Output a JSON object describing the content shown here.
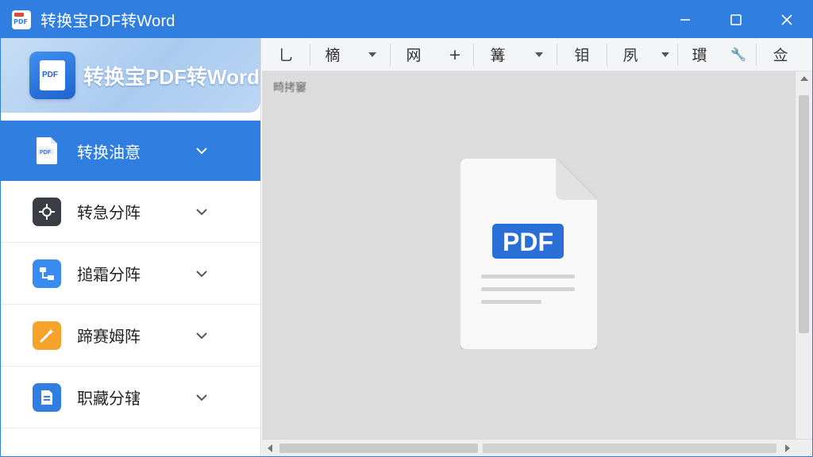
{
  "window": {
    "title": "转换宝PDF转Word",
    "controls": [
      "minimize-icon",
      "maximize-icon",
      "close-icon"
    ]
  },
  "brand": {
    "name": "转换宝PDF转Word",
    "logo_text": "PDF"
  },
  "colors": {
    "accent": "#2f7ee0",
    "brand_panel": "#aacbef",
    "content_bg": "#dcdcdc"
  },
  "sidebar": {
    "items": [
      {
        "label": "转换油意",
        "icon": "pdf-file-icon",
        "active": true
      },
      {
        "label": "转急分阵",
        "icon": "gear-split-icon",
        "active": false
      },
      {
        "label": "搥霜分阵",
        "icon": "flow-icon",
        "active": false
      },
      {
        "label": "蹄赛姆阵",
        "icon": "magic-wand-icon",
        "active": false
      },
      {
        "label": "职藏分辖",
        "icon": "document-list-icon",
        "active": false
      }
    ]
  },
  "toolbar": {
    "items": [
      {
        "label": "乚"
      },
      {
        "label": "樀",
        "dropdown": true
      },
      {
        "label": "网"
      },
      {
        "label": "+"
      },
      {
        "label": "篝",
        "dropdown": true
      },
      {
        "label": "钼"
      },
      {
        "label": "夙",
        "dropdown": true
      },
      {
        "label": "瑻"
      },
      {
        "label": "🔧"
      },
      {
        "label": "佥"
      }
    ]
  },
  "content": {
    "label": "畸拷窶",
    "doc_badge": "PDF"
  }
}
